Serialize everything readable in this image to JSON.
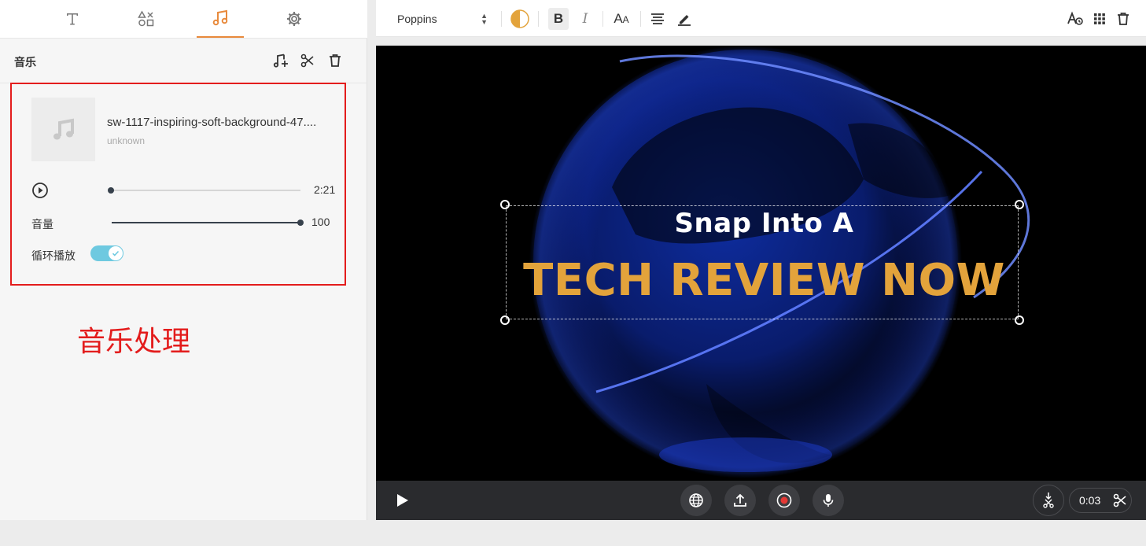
{
  "tabs": [
    {
      "name": "text",
      "icon": "text-icon"
    },
    {
      "name": "elements",
      "icon": "shapes-icon"
    },
    {
      "name": "music",
      "icon": "music-note-icon",
      "active": true
    },
    {
      "name": "settings",
      "icon": "gear-icon"
    }
  ],
  "panel": {
    "title": "音乐",
    "actions": [
      "add-music-icon",
      "scissors-icon",
      "trash-icon"
    ]
  },
  "track": {
    "name": "sw-1117-inspiring-soft-background-47....",
    "artist": "unknown",
    "duration": "2:21",
    "progress_fraction": 0.0
  },
  "volume": {
    "label": "音量",
    "value": "100",
    "fraction": 1.0
  },
  "loop": {
    "label": "循环播放",
    "enabled": true
  },
  "annotation": "音乐处理",
  "toolbar": {
    "font": "Poppins",
    "buttons": [
      "color-fill-icon",
      "bold-icon",
      "italic-icon",
      "font-size-icon",
      "align-icon",
      "pen-icon",
      "text-style-icon",
      "grid-icon",
      "trash-icon"
    ]
  },
  "canvas": {
    "subtitle": "Snap Into A",
    "headline": "TECH REVIEW NOW",
    "headline_color": "#e3a33b"
  },
  "player": {
    "time": "0:03",
    "buttons": [
      "globe-icon",
      "upload-icon",
      "record-icon",
      "microphone-icon"
    ]
  },
  "colors": {
    "accent": "#e88a3c",
    "annotation_red": "#e31c1c",
    "toggle_on": "#6ec9e0"
  }
}
